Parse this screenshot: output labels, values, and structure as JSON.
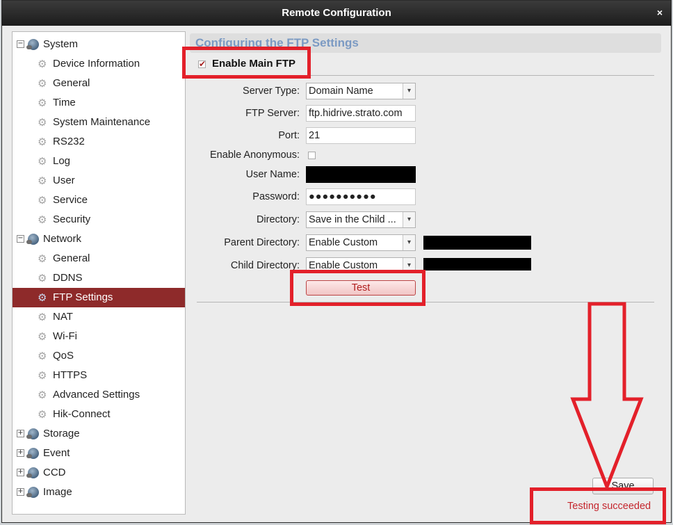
{
  "window": {
    "title": "Remote Configuration",
    "close_glyph": "×"
  },
  "tree": {
    "groups": [
      {
        "label": "System",
        "toggle": "−",
        "children": [
          "Device Information",
          "General",
          "Time",
          "System Maintenance",
          "RS232",
          "Log",
          "User",
          "Service",
          "Security"
        ]
      },
      {
        "label": "Network",
        "toggle": "−",
        "children": [
          "General",
          "DDNS",
          "FTP Settings",
          "NAT",
          "Wi-Fi",
          "QoS",
          "HTTPS",
          "Advanced Settings",
          "Hik-Connect"
        ]
      },
      {
        "label": "Storage",
        "toggle": "+"
      },
      {
        "label": "Event",
        "toggle": "+"
      },
      {
        "label": "CCD",
        "toggle": "+"
      },
      {
        "label": "Image",
        "toggle": "+"
      }
    ],
    "selected": "FTP Settings"
  },
  "panel": {
    "title": "Configuring the FTP Settings",
    "enable_main_ftp": {
      "label": "Enable Main FTP",
      "checked": true
    }
  },
  "form": {
    "server_type": {
      "label": "Server Type:",
      "value": "Domain Name"
    },
    "ftp_server": {
      "label": "FTP Server:",
      "value": "ftp.hidrive.strato.com"
    },
    "port": {
      "label": "Port:",
      "value": "21"
    },
    "enable_anonymous": {
      "label": "Enable Anonymous:",
      "checked": false
    },
    "user_name": {
      "label": "User Name:"
    },
    "password": {
      "label": "Password:",
      "value": "●●●●●●●●●●"
    },
    "directory": {
      "label": "Directory:",
      "value": "Save in the Child ..."
    },
    "parent_directory": {
      "label": "Parent Directory:",
      "value": "Enable Custom"
    },
    "child_directory": {
      "label": "Child Directory:",
      "value": "Enable Custom"
    }
  },
  "buttons": {
    "test": "Test",
    "save": "Save"
  },
  "status": {
    "text": "Testing succeeded"
  },
  "icons": {
    "arrow": "▾",
    "gear": "⚙"
  },
  "colors": {
    "selected_bg": "#8e2a2a",
    "title_blue": "#7b9ac3",
    "highlight_red": "#e3202a"
  }
}
